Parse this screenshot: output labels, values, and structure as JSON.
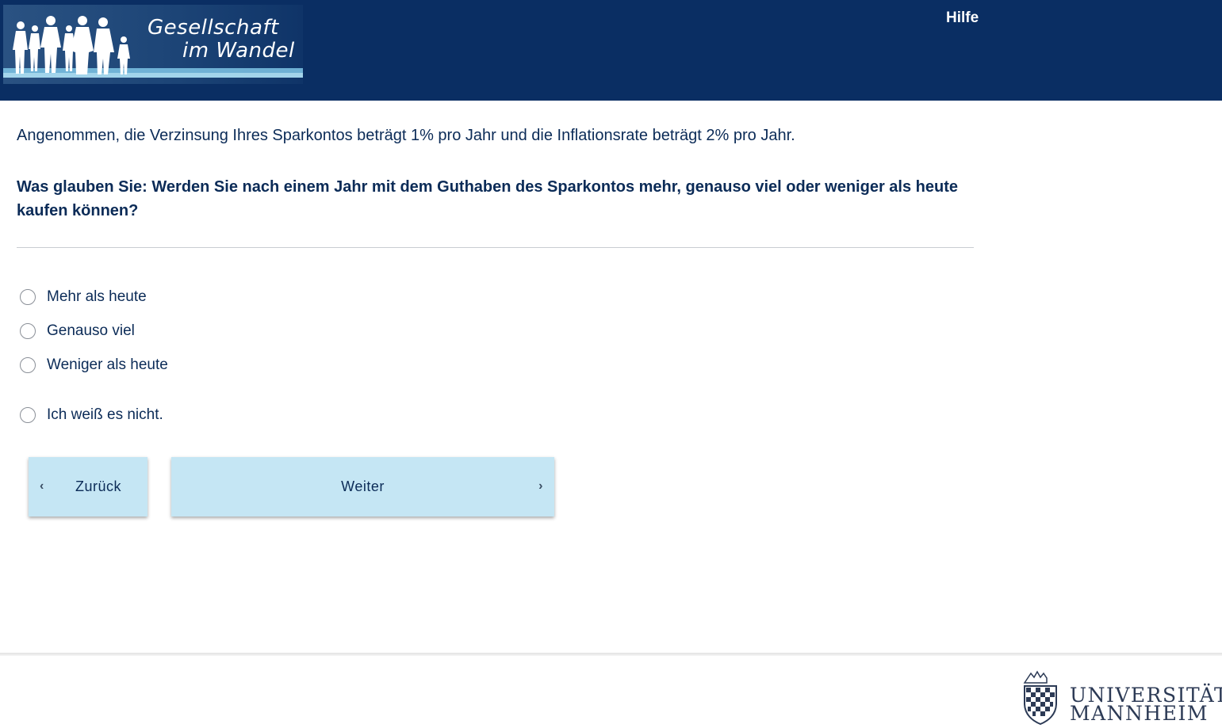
{
  "header": {
    "logo_line1": "Gesellschaft",
    "logo_line2": "im Wandel",
    "help_label": "Hilfe"
  },
  "question": {
    "intro": "Angenommen, die Verzinsung Ihres Sparkontos beträgt 1% pro Jahr und die Inflationsrate beträgt 2% pro Jahr.",
    "text": "Was glauben Sie: Werden Sie nach einem Jahr mit dem Guthaben des Sparkontos mehr, genauso viel oder weniger als heute kaufen können?"
  },
  "options": [
    {
      "label": "Mehr als heute",
      "selected": false
    },
    {
      "label": "Genauso viel",
      "selected": false
    },
    {
      "label": "Weniger als heute",
      "selected": false
    },
    {
      "label": "Ich weiß es nicht.",
      "selected": false
    }
  ],
  "navigation": {
    "back_label": "Zurück",
    "next_label": "Weiter",
    "back_icon": "chevron-left-icon",
    "next_icon": "chevron-right-icon"
  },
  "footer": {
    "university_line1": "UNIVERSITÄT",
    "university_line2": "MANNHEIM"
  },
  "colors": {
    "header_bg": "#0a2e63",
    "text": "#0b2b57",
    "button_bg": "#c5e6f4"
  }
}
